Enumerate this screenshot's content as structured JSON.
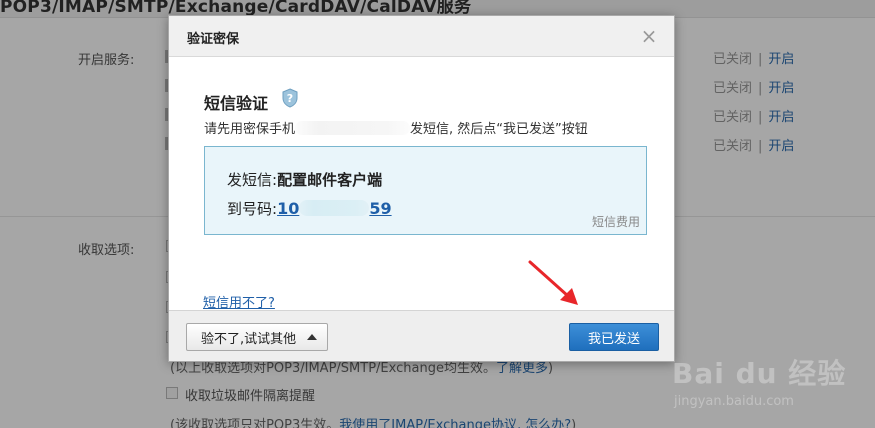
{
  "background": {
    "section_title": "POP3/IMAP/SMTP/Exchange/CardDAV/CalDAV服务",
    "services_label": "开启服务:",
    "services": [
      {
        "status": "已关闭",
        "separator": "|",
        "action": "开启"
      },
      {
        "status": "已关闭",
        "separator": "|",
        "action": "开启"
      },
      {
        "status": "已关闭",
        "separator": "|",
        "action": "开启"
      },
      {
        "status": "已关闭",
        "separator": "|",
        "action": "开启"
      }
    ],
    "fetch_label": "收取选项:",
    "note_prefix": "(以上收取选项对POP3/IMAP/SMTP/Exchange均生效。",
    "note_link": "了解更多",
    "note_suffix": ")",
    "junk_checkbox_label": "收取垃圾邮件隔离提醒",
    "pop3_note_prefix": "(该收取选项只对POP3生效。",
    "pop3_note_link": "我使用了IMAP/Exchange协议, 怎么办?",
    "pop3_note_suffix": ")"
  },
  "dialog": {
    "title": "验证密保",
    "close_symbol": "×",
    "heading": "短信验证",
    "instruction_prefix": "请先用密保手机",
    "instruction_suffix": "发短信, 然后点“我已发送”按钮",
    "sms_label": "发短信:",
    "sms_content": "配置邮件客户端",
    "number_label": "到号码:",
    "number_prefix": "10",
    "number_suffix": "59",
    "fee_label": "短信费用",
    "help_link": "短信用不了?",
    "alt_button": "验不了,试试其他",
    "confirm_button": "我已发送"
  },
  "watermark": {
    "brand": "Bai du 经验",
    "url": "jingyan.baidu.com"
  },
  "colors": {
    "link": "#1f5fa8",
    "primary_button": "#1f6fbd",
    "info_box_bg": "#e9f5fa",
    "info_box_border": "#7ab6cf",
    "annotation_arrow": "#e8262a"
  }
}
